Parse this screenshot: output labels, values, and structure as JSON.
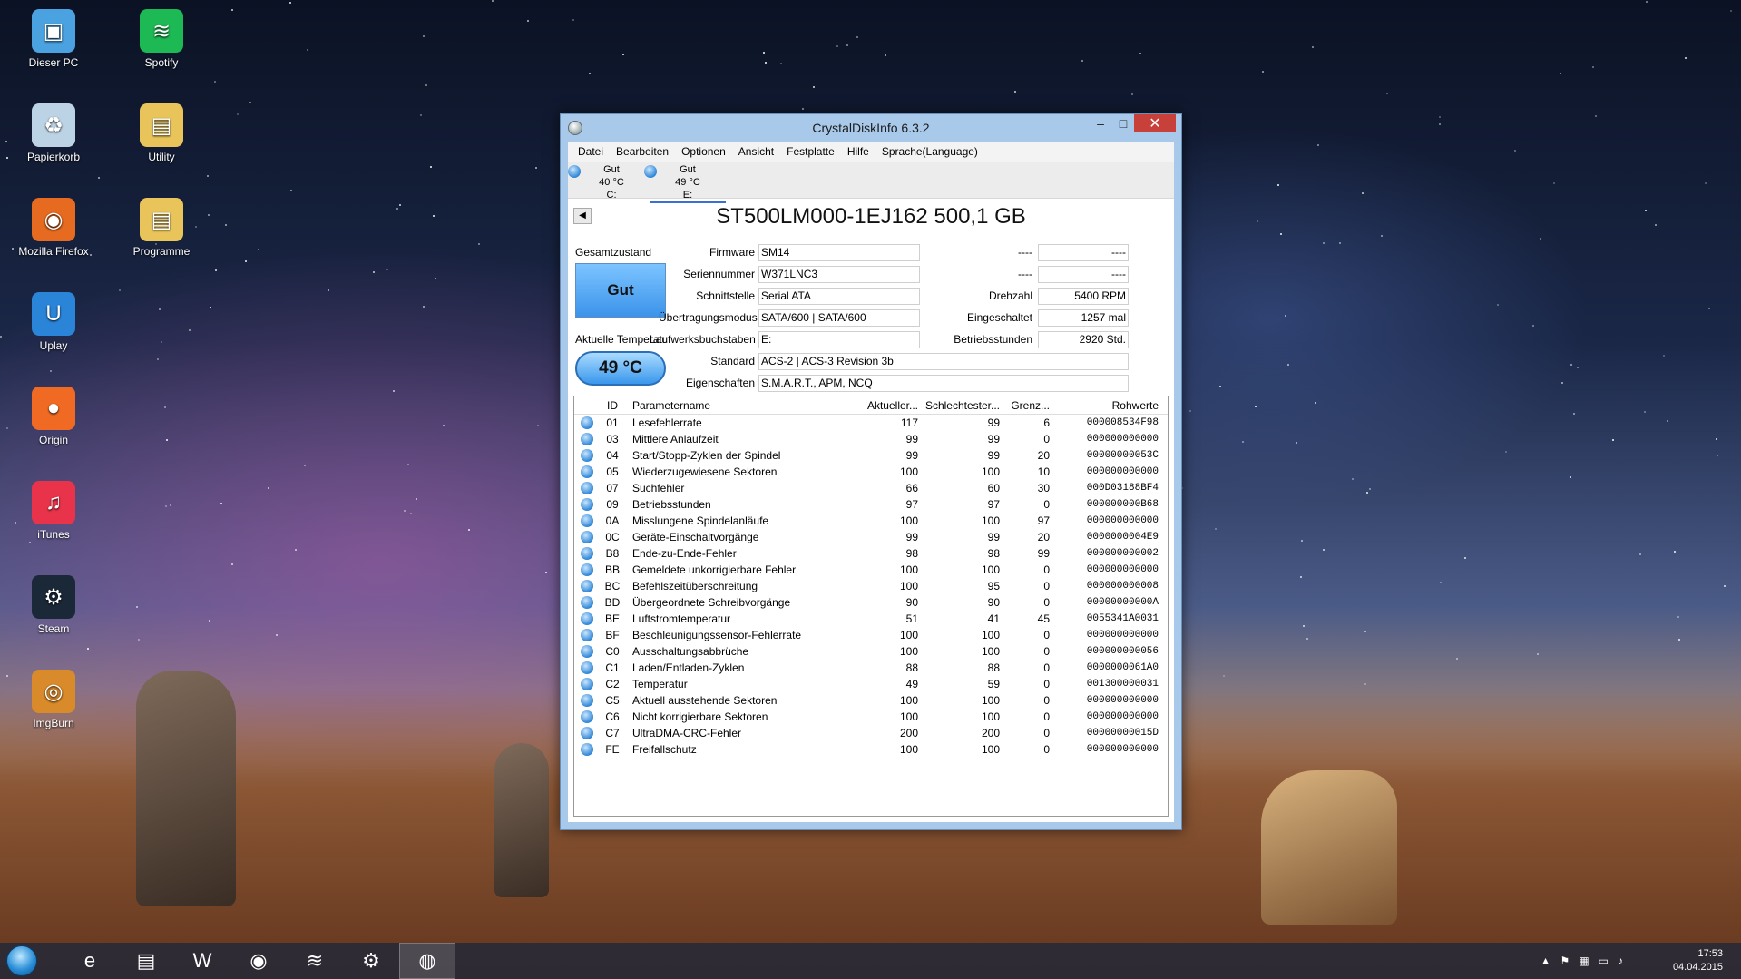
{
  "desktop": {
    "icons": [
      {
        "label": "Dieser PC",
        "icon": "computer-icon"
      },
      {
        "label": "Spotify",
        "icon": "spotify-icon"
      },
      {
        "label": "Papierkorb",
        "icon": "recycle-bin-icon"
      },
      {
        "label": "Utility",
        "icon": "folder-icon"
      },
      {
        "label": "Mozilla Firefox",
        "icon": "firefox-icon"
      },
      {
        "label": "Programme",
        "icon": "folder-icon"
      },
      {
        "label": "Uplay",
        "icon": "uplay-icon"
      },
      {
        "label": "Origin",
        "icon": "origin-icon"
      },
      {
        "label": "iTunes",
        "icon": "itunes-icon"
      },
      {
        "label": "Steam",
        "icon": "steam-icon"
      },
      {
        "label": "ImgBurn",
        "icon": "imgburn-icon"
      }
    ]
  },
  "window": {
    "title": "CrystalDiskInfo 6.3.2",
    "minimize": "–",
    "maximize": "□",
    "close": "✕",
    "menu": [
      "Datei",
      "Bearbeiten",
      "Optionen",
      "Ansicht",
      "Festplatte",
      "Hilfe",
      "Sprache(Language)"
    ],
    "disks": [
      {
        "status": "Gut",
        "temp": "40 °C",
        "letter": "C:"
      },
      {
        "status": "Gut",
        "temp": "49 °C",
        "letter": "E:"
      }
    ],
    "nav_arrow": "◀",
    "model": "ST500LM000-1EJ162 500,1 GB",
    "health_label": "Gesamtzustand",
    "health_value": "Gut",
    "temp_label": "Aktuelle Temperatur",
    "temp_value": "49 °C",
    "fields": {
      "firmware_label": "Firmware",
      "firmware": "SM14",
      "serial_label": "Seriennummer",
      "serial": "W371LNC3",
      "interface_label": "Schnittstelle",
      "interface": "Serial ATA",
      "transfer_label": "Übertragungsmodus",
      "transfer": "SATA/600 | SATA/600",
      "drive_label": "Laufwerksbuchstaben",
      "drive": "E:",
      "standard_label": "Standard",
      "standard": "ACS-2 | ACS-3 Revision 3b",
      "features_label": "Eigenschaften",
      "features": "S.M.A.R.T., APM, NCQ",
      "blank1_label": "----",
      "blank1": "----",
      "blank2_label": "----",
      "blank2": "----",
      "rpm_label": "Drehzahl",
      "rpm": "5400 RPM",
      "power_on_count_label": "Eingeschaltet",
      "power_on_count": "1257 mal",
      "power_on_hours_label": "Betriebsstunden",
      "power_on_hours": "2920 Std."
    },
    "table": {
      "headers": [
        "ID",
        "Parametername",
        "Aktueller...",
        "Schlechtester...",
        "Grenz...",
        "Rohwerte"
      ],
      "rows": [
        [
          "01",
          "Lesefehlerrate",
          "117",
          "99",
          "6",
          "000008534F98"
        ],
        [
          "03",
          "Mittlere Anlaufzeit",
          "99",
          "99",
          "0",
          "000000000000"
        ],
        [
          "04",
          "Start/Stopp-Zyklen der Spindel",
          "99",
          "99",
          "20",
          "00000000053C"
        ],
        [
          "05",
          "Wiederzugewiesene Sektoren",
          "100",
          "100",
          "10",
          "000000000000"
        ],
        [
          "07",
          "Suchfehler",
          "66",
          "60",
          "30",
          "000D03188BF4"
        ],
        [
          "09",
          "Betriebsstunden",
          "97",
          "97",
          "0",
          "000000000B68"
        ],
        [
          "0A",
          "Misslungene Spindelanläufe",
          "100",
          "100",
          "97",
          "000000000000"
        ],
        [
          "0C",
          "Geräte-Einschaltvorgänge",
          "99",
          "99",
          "20",
          "0000000004E9"
        ],
        [
          "B8",
          "Ende-zu-Ende-Fehler",
          "98",
          "98",
          "99",
          "000000000002"
        ],
        [
          "BB",
          "Gemeldete unkorrigierbare Fehler",
          "100",
          "100",
          "0",
          "000000000000"
        ],
        [
          "BC",
          "Befehlszeitüberschreitung",
          "100",
          "95",
          "0",
          "000000000008"
        ],
        [
          "BD",
          "Übergeordnete Schreibvorgänge",
          "90",
          "90",
          "0",
          "00000000000A"
        ],
        [
          "BE",
          "Luftstromtemperatur",
          "51",
          "41",
          "45",
          "0055341A0031"
        ],
        [
          "BF",
          "Beschleunigungssensor-Fehlerrate",
          "100",
          "100",
          "0",
          "000000000000"
        ],
        [
          "C0",
          "Ausschaltungsabbrüche",
          "100",
          "100",
          "0",
          "000000000056"
        ],
        [
          "C1",
          "Laden/Entladen-Zyklen",
          "88",
          "88",
          "0",
          "0000000061A0"
        ],
        [
          "C2",
          "Temperatur",
          "49",
          "59",
          "0",
          "001300000031"
        ],
        [
          "C5",
          "Aktuell ausstehende Sektoren",
          "100",
          "100",
          "0",
          "000000000000"
        ],
        [
          "C6",
          "Nicht korrigierbare Sektoren",
          "100",
          "100",
          "0",
          "000000000000"
        ],
        [
          "C7",
          "UltraDMA-CRC-Fehler",
          "200",
          "200",
          "0",
          "00000000015D"
        ],
        [
          "FE",
          "Freifallschutz",
          "100",
          "100",
          "0",
          "000000000000"
        ]
      ]
    }
  },
  "taskbar": {
    "apps": [
      {
        "name": "internet-explorer-icon",
        "glyph": "e"
      },
      {
        "name": "file-explorer-icon",
        "glyph": "▤"
      },
      {
        "name": "word-icon",
        "glyph": "W"
      },
      {
        "name": "firefox-icon",
        "glyph": "◉"
      },
      {
        "name": "spotify-icon",
        "glyph": "≋"
      },
      {
        "name": "steam-icon",
        "glyph": "⚙"
      },
      {
        "name": "crystaldiskinfo-icon",
        "glyph": "◍"
      }
    ],
    "time": "17:53",
    "date": "04.04.2015"
  }
}
